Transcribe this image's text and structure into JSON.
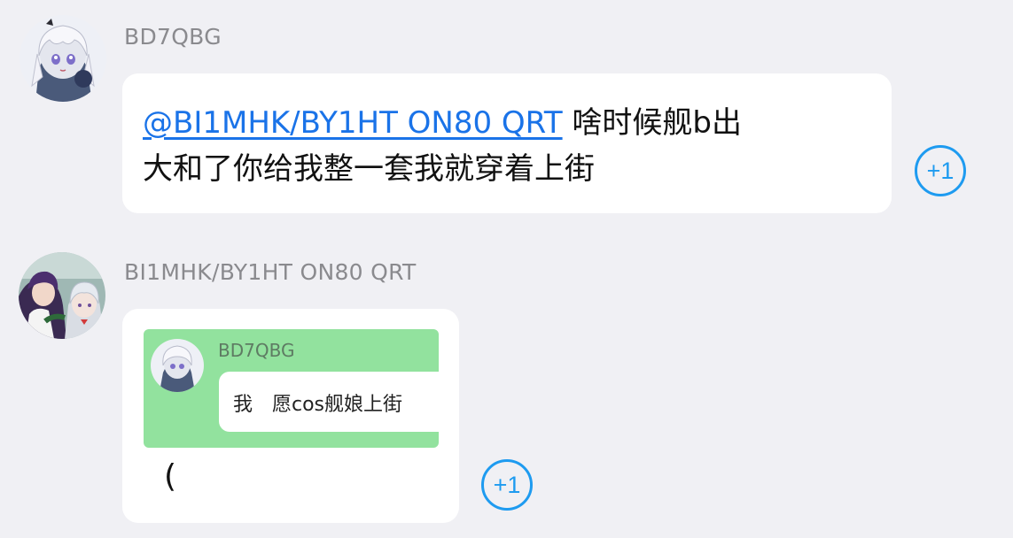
{
  "messages": [
    {
      "sender": "BD7QBG",
      "mention": "@BI1MHK/BY1HT ON80 QRT",
      "text_line1_rest": " 啥时候舰b出",
      "text_line2": "大和了你给我整一套我就穿着上街",
      "reaction": "+1"
    },
    {
      "sender": "BI1MHK/BY1HT ON80 QRT",
      "quote": {
        "sender": "BD7QBG",
        "text": "我　愿cos舰娘上街"
      },
      "text": "(",
      "reaction": "+1"
    }
  ],
  "colors": {
    "background": "#f0f0f4",
    "bubble": "#ffffff",
    "mention": "#1a73e8",
    "reaction": "#1e9bf0",
    "quote_background": "#92e29e"
  },
  "icons": {
    "avatar_1": "anime-girl-silver-hair-avatar",
    "avatar_2": "anime-characters-avatar"
  }
}
